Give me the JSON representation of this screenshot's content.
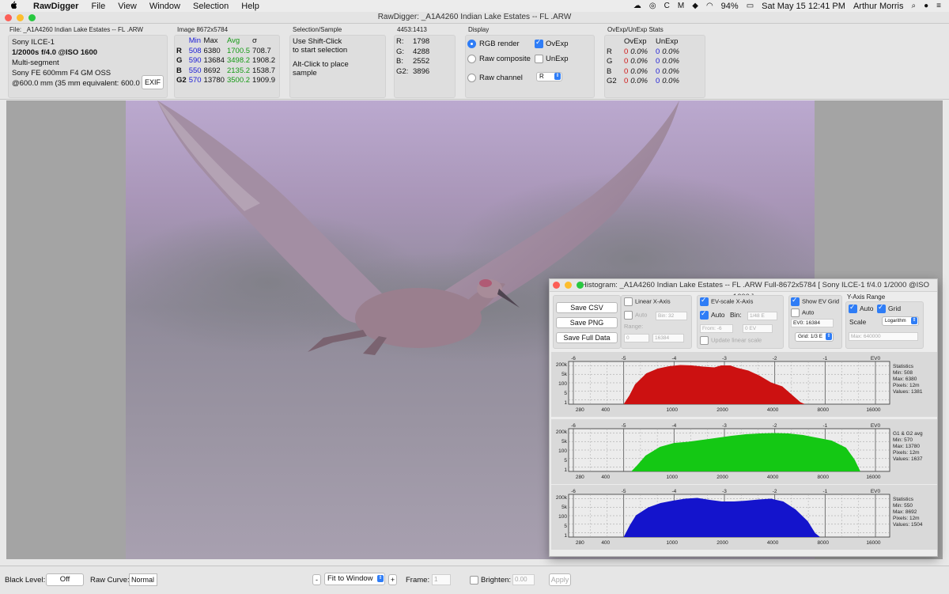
{
  "menubar": {
    "apple": "",
    "app": "RawDigger",
    "items": [
      "File",
      "View",
      "Window",
      "Selection",
      "Help"
    ],
    "battery": "94%",
    "datetime": "Sat May 15  12:41 PM",
    "user": "Arthur Morris"
  },
  "window": {
    "title": "RawDigger: _A1A4260  Indian Lake Estates -- FL .ARW"
  },
  "file": {
    "header": "File: _A1A4260  Indian Lake Estates -- FL .ARW",
    "camera": "Sony ILCE-1",
    "exposure": "1/2000s f/4.0 @ISO 1600",
    "metering": "Multi-segment",
    "lens": "Sony FE 600mm F4 GM OSS",
    "focal": "@600.0 mm (35 mm equivalent: 600.0 mm)",
    "exif_label": "EXIF"
  },
  "image": {
    "header": "Image 8672x5784",
    "cols": [
      "Min",
      "Max",
      "Avg",
      "σ"
    ],
    "rows": [
      [
        "R",
        "508",
        "6380",
        "1700.5",
        "708.7"
      ],
      [
        "G",
        "590",
        "13684",
        "3498.2",
        "1908.2"
      ],
      [
        "B",
        "550",
        "8692",
        "2135.2",
        "1538.7"
      ],
      [
        "G2",
        "570",
        "13780",
        "3500.2",
        "1909.9"
      ]
    ]
  },
  "selection": {
    "header": "Selection/Sample",
    "line1": "Use Shift-Click",
    "line2": "to start selection",
    "line3": "Alt-Click to place",
    "line4": "sample"
  },
  "sample": {
    "header": "4453:1413",
    "rows": [
      [
        "R:",
        "1798"
      ],
      [
        "G:",
        "4288"
      ],
      [
        "B:",
        "2552"
      ],
      [
        "G2:",
        "3896"
      ]
    ]
  },
  "display": {
    "header": "Display",
    "rgb_render": "RGB render",
    "raw_composite": "Raw composite",
    "raw_channel": "Raw channel",
    "ovexp": "OvExp",
    "unexp": "UnExp",
    "channel_value": "R"
  },
  "stats": {
    "header": "OvExp/UnExp Stats",
    "cols": [
      "OvExp",
      "UnExp"
    ],
    "rows": [
      [
        "R",
        "0",
        "0.0%",
        "0",
        "0.0%"
      ],
      [
        "G",
        "0",
        "0.0%",
        "0",
        "0.0%"
      ],
      [
        "B",
        "0",
        "0.0%",
        "0",
        "0.0%"
      ],
      [
        "G2",
        "0",
        "0.0%",
        "0",
        "0.0%"
      ]
    ]
  },
  "bottom": {
    "black_level_label": "Black Level:",
    "black_level_value": "Off",
    "raw_curve_label": "Raw Curve:",
    "raw_curve_value": "Normal",
    "minus": "-",
    "zoom_value": "Fit to Window",
    "plus": "+",
    "frame_label": "Frame:",
    "frame_value": "1",
    "brighten_label": "Brighten:",
    "brighten_value": "0.00",
    "apply": "Apply"
  },
  "histogram": {
    "title": "Histogram: _A1A4260  Indian Lake Estates -- FL .ARW Full-8672x5784 [ Sony ILCE-1 f/4.0 1/2000 @ISO 1600 ]",
    "save_csv": "Save CSV",
    "save_png": "Save PNG",
    "save_full": "Save Full Data",
    "linear_x": "Linear X-Axis",
    "auto": "Auto",
    "bin_label": "Bin:",
    "bin_value": "32",
    "range_label": "Range:",
    "range_from": "0",
    "range_to": "16384",
    "ev_scale": "EV-scale X-Axis",
    "bin2_label": "Bin:",
    "bin2_value": "1/48 E",
    "from_ev": "From: -6",
    "to_ev": "0 EV",
    "update_linear": "Update linear scale",
    "show_ev_grid": "Show EV Grid",
    "ev0_value": "EV0: 16384",
    "grid_value": "Grid: 1/3 E",
    "y_range": "Y-Axis Range",
    "y_auto": "Auto",
    "y_grid": "Grid",
    "scale_label": "Scale",
    "scale_value": "Logarithm",
    "max_value": "Max: 640000",
    "ev_ticks": [
      "-6",
      "-5",
      "-4",
      "-3",
      "-2",
      "-1",
      "EV0"
    ],
    "x_ticks": [
      "280",
      "400",
      "1000",
      "2000",
      "4000",
      "8000",
      "16000"
    ],
    "y_ticks": [
      "200k",
      "5k",
      "100",
      "5",
      "1"
    ],
    "panels": [
      {
        "color": "#cc1111",
        "stats": [
          "Statistics",
          "Min: 508",
          "Max: 6380",
          "Pixels: 12m",
          "Values: 1381"
        ],
        "profile": [
          [
            0,
            0
          ],
          [
            0.5,
            0.22
          ],
          [
            1,
            0.5
          ],
          [
            2,
            0.78
          ],
          [
            3,
            0.9
          ],
          [
            4,
            0.96
          ],
          [
            5,
            0.99
          ],
          [
            6,
            0.98
          ],
          [
            7,
            0.95
          ],
          [
            8,
            0.93
          ],
          [
            8.6,
            0.98
          ],
          [
            9.4,
            0.98
          ],
          [
            10,
            0.92
          ],
          [
            11,
            0.85
          ],
          [
            12,
            0.72
          ],
          [
            13,
            0.55
          ],
          [
            14,
            0.45
          ],
          [
            15,
            0.2
          ],
          [
            15.6,
            0.05
          ],
          [
            16,
            0
          ]
        ],
        "start_ev": -5.0,
        "end_ev": -1.4
      },
      {
        "color": "#14c814",
        "stats": [
          "G1 & G2 avg",
          "Min: 570",
          "Max: 13780",
          "Pixels: 12m",
          "Values: 1637"
        ],
        "profile": [
          [
            0,
            0
          ],
          [
            0.4,
            0.15
          ],
          [
            1,
            0.4
          ],
          [
            2,
            0.62
          ],
          [
            3,
            0.72
          ],
          [
            4,
            0.75
          ],
          [
            5,
            0.8
          ],
          [
            6,
            0.85
          ],
          [
            7,
            0.9
          ],
          [
            8,
            0.94
          ],
          [
            9,
            0.96
          ],
          [
            10,
            0.97
          ],
          [
            11,
            0.96
          ],
          [
            12,
            0.92
          ],
          [
            13,
            0.85
          ],
          [
            14,
            0.78
          ],
          [
            15,
            0.6
          ],
          [
            15.6,
            0.3
          ],
          [
            16,
            0
          ]
        ],
        "start_ev": -4.85,
        "end_ev": -0.3
      },
      {
        "color": "#1414cc",
        "stats": [
          "Statistics",
          "Min: 550",
          "Max: 8692",
          "Pixels: 12m",
          "Values: 1504"
        ],
        "profile": [
          [
            0,
            0
          ],
          [
            0.5,
            0.3
          ],
          [
            1,
            0.55
          ],
          [
            2,
            0.75
          ],
          [
            3,
            0.86
          ],
          [
            4,
            0.92
          ],
          [
            5,
            0.97
          ],
          [
            6,
            0.99
          ],
          [
            7,
            0.94
          ],
          [
            8,
            0.9
          ],
          [
            9,
            0.9
          ],
          [
            10,
            0.92
          ],
          [
            11,
            0.95
          ],
          [
            12,
            0.97
          ],
          [
            13,
            0.9
          ],
          [
            14,
            0.7
          ],
          [
            15,
            0.4
          ],
          [
            15.6,
            0.1
          ],
          [
            16,
            0
          ]
        ],
        "start_ev": -5.0,
        "end_ev": -1.1
      }
    ]
  }
}
